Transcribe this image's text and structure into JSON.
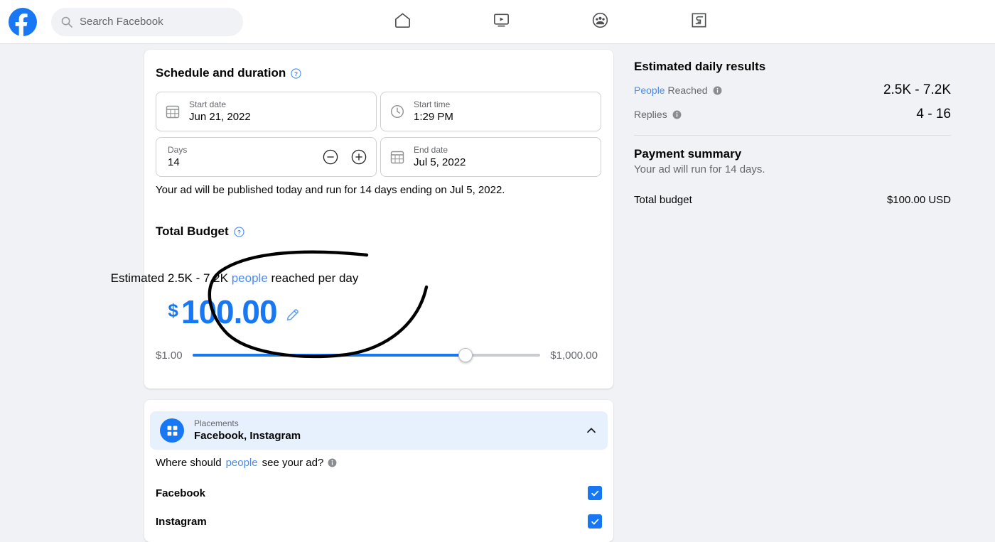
{
  "topbar": {
    "logo": "facebook-logo",
    "search": {
      "placeholder": "Search Facebook",
      "value": "",
      "icon": "search-icon"
    },
    "nav": [
      {
        "name": "home",
        "icon": "home-icon"
      },
      {
        "name": "watch",
        "icon": "video-screen-icon"
      },
      {
        "name": "groups",
        "icon": "groups-icon"
      },
      {
        "name": "gaming",
        "icon": "gaming-icon"
      }
    ]
  },
  "schedule": {
    "title": "Schedule and duration",
    "help_icon": "question-mark-icon",
    "start_date": {
      "label": "Start date",
      "value": "Jun 21, 2022",
      "icon": "calendar-icon"
    },
    "start_time": {
      "label": "Start time",
      "value": "1:29 PM",
      "icon": "clock-icon"
    },
    "days": {
      "label": "Days",
      "value": "14",
      "decrement_icon": "minus-circle-icon",
      "increment_icon": "plus-circle-icon"
    },
    "end_date": {
      "label": "End date",
      "value": "Jul 5, 2022",
      "icon": "calendar-icon"
    },
    "note": "Your ad will be published today and run for 14 days ending on Jul 5, 2022."
  },
  "budget": {
    "title": "Total Budget",
    "help_icon": "question-mark-icon",
    "estimate_prefix": "Estimated 2.5K - 7.2K",
    "estimate_link": "people",
    "estimate_suffix": "reached per day",
    "currency_symbol": "$",
    "amount": "100.00",
    "edit_icon": "pencil-icon",
    "slider": {
      "min_label": "$1.00",
      "max_label": "$1,000.00",
      "fill_percent": 78.5
    },
    "accent_color": "#1877f2",
    "annotation": "hand-drawn-circle-highlight"
  },
  "placements": {
    "header_label": "Placements",
    "header_value": "Facebook, Instagram",
    "badge_icon": "grid-icon",
    "collapse_icon": "chevron-up-icon",
    "question_prefix": "Where should",
    "question_link": "people",
    "question_suffix": "see your ad?",
    "info_icon": "info-icon",
    "options": [
      {
        "name": "Facebook",
        "checked": true,
        "check_icon": "checkmark-icon"
      },
      {
        "name": "Instagram",
        "checked": true,
        "check_icon": "checkmark-icon"
      }
    ]
  },
  "right_panel": {
    "results_title": "Estimated daily results",
    "rows": [
      {
        "key_link": "People",
        "key_rest": "Reached",
        "info_icon": "info-icon",
        "value": "2.5K - 7.2K"
      },
      {
        "key_link": "",
        "key_rest": "Replies",
        "info_icon": "info-icon",
        "value": "4 - 16"
      }
    ],
    "payment_title": "Payment summary",
    "payment_sub": "Your ad will run for 14 days.",
    "total_key": "Total budget",
    "total_value": "$100.00 USD"
  }
}
